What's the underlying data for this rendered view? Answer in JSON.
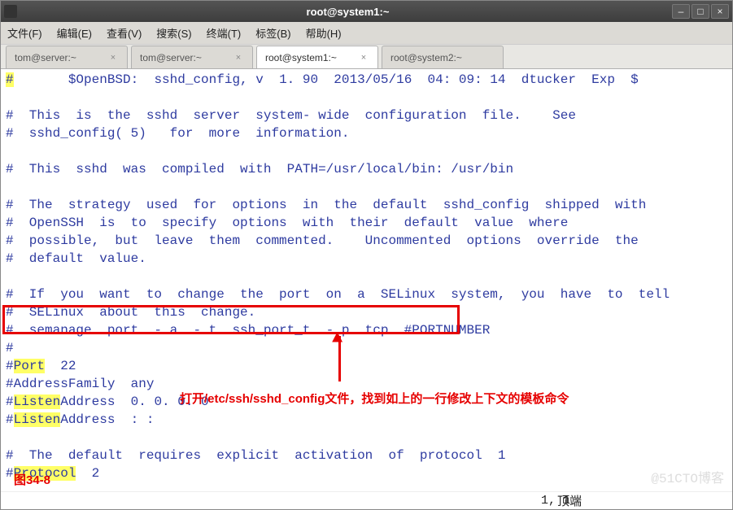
{
  "window": {
    "title": "root@system1:~"
  },
  "menu": {
    "file": "文件(F)",
    "edit": "编辑(E)",
    "view": "查看(V)",
    "search": "搜索(S)",
    "terminal": "终端(T)",
    "tabs": "标签(B)",
    "help": "帮助(H)"
  },
  "tabs": [
    {
      "label": "tom@server:~",
      "active": false
    },
    {
      "label": "tom@server:~",
      "active": false
    },
    {
      "label": "root@system1:~",
      "active": true
    },
    {
      "label": "root@system2:~",
      "active": false,
      "noclose": true
    }
  ],
  "content": {
    "l0a": "#",
    "l0b": "       $OpenBSD:  sshd_config, v  1. 90  2013/05/16  04: 09: 14  dtucker  Exp  $",
    "l1": " ",
    "l2": "#  This  is  the  sshd  server  system- wide  configuration  file.    See",
    "l3": "#  sshd_config( 5)   for  more  information.",
    "l4": " ",
    "l5": "#  This  sshd  was  compiled  with  PATH=/usr/local/bin: /usr/bin",
    "l6": " ",
    "l7": "#  The  strategy  used  for  options  in  the  default  sshd_config  shipped  with",
    "l8": "#  OpenSSH  is  to  specify  options  with  their  default  value  where",
    "l9": "#  possible,  but  leave  them  commented.    Uncommented  options  override  the",
    "l10": "#  default  value.",
    "l11": " ",
    "l12": "#  If  you  want  to  change  the  port  on  a  SELinux  system,  you  have  to  tell",
    "l13": "#  SELinux  about  this  change.",
    "l14": "#  semanage  port  - a  - t  ssh_port_t  - p  tcp  #PORTNUMBER",
    "l15": "#",
    "l16a": "#",
    "l16b": "Port",
    "l16c": "  22",
    "l17a": "#",
    "l17b": "AddressFamily  any",
    "l18a": "#",
    "l18b": "Listen",
    "l18c": "Address  0. 0. 0. 0",
    "l19a": "#",
    "l19b": "Listen",
    "l19c": "Address  : :",
    "l20": " ",
    "l21": "#  The  default  requires  explicit  activation  of  protocol  1",
    "l22a": "#",
    "l22b": "Protocol",
    "l22c": "  2"
  },
  "annotation": {
    "text": "打开/etc/ssh/sshd_config文件，找到如上的一行修改上下文的模板命令",
    "figure": "图34-8"
  },
  "status": {
    "pos": "1, 1",
    "right": "顶端"
  },
  "watermark": "@51CTO博客"
}
